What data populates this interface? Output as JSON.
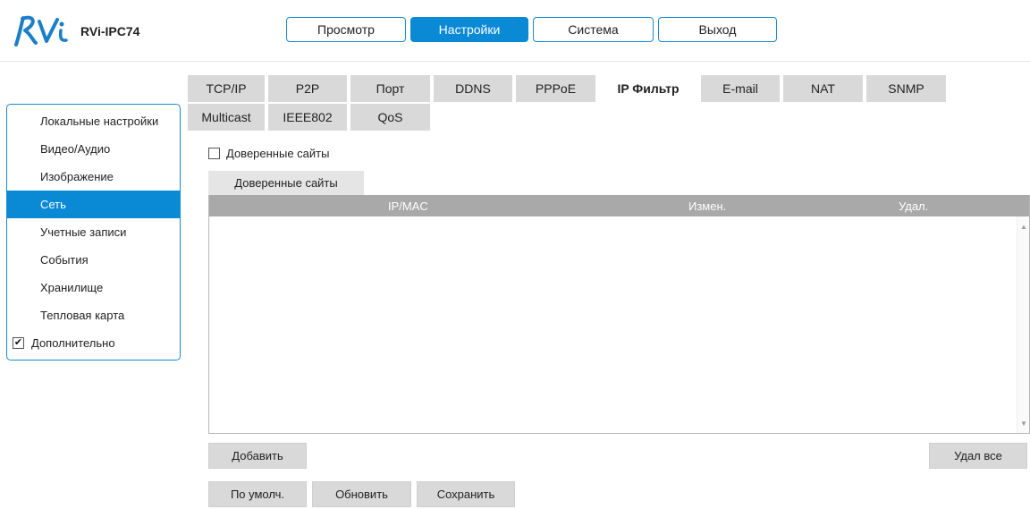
{
  "header": {
    "model": "RVi-IPC74",
    "nav": [
      {
        "label": "Просмотр",
        "active": false
      },
      {
        "label": "Настройки",
        "active": true
      },
      {
        "label": "Система",
        "active": false
      },
      {
        "label": "Выход",
        "active": false
      }
    ]
  },
  "sidebar": {
    "items": [
      {
        "label": "Локальные настройки",
        "active": false
      },
      {
        "label": "Видео/Аудио",
        "active": false
      },
      {
        "label": "Изображение",
        "active": false
      },
      {
        "label": "Сеть",
        "active": true
      },
      {
        "label": "Учетные записи",
        "active": false
      },
      {
        "label": "События",
        "active": false
      },
      {
        "label": "Хранилище",
        "active": false
      },
      {
        "label": "Тепловая карта",
        "active": false
      }
    ],
    "advanced": {
      "label": "Дополнительно",
      "checked": true
    }
  },
  "tabs": {
    "row1": [
      "TCP/IP",
      "P2P",
      "Порт",
      "DDNS",
      "PPPoE",
      "IP Фильтр",
      "E-mail",
      "NAT",
      "SNMP"
    ],
    "row2": [
      "Multicast",
      "IEEE802",
      "QoS"
    ],
    "active": "IP Фильтр"
  },
  "filter": {
    "trusted_label": "Доверенные сайты",
    "trusted_checked": false,
    "subtab_label": "Доверенные сайты",
    "columns": {
      "ipmac": "IP/MAC",
      "edit": "Измен.",
      "delete": "Удал."
    }
  },
  "buttons": {
    "add": "Добавить",
    "delete_all": "Удал все",
    "default": "По умолч.",
    "refresh": "Обновить",
    "save": "Сохранить"
  },
  "colors": {
    "accent": "#0a89d4",
    "logo": "#1a7fc8"
  }
}
